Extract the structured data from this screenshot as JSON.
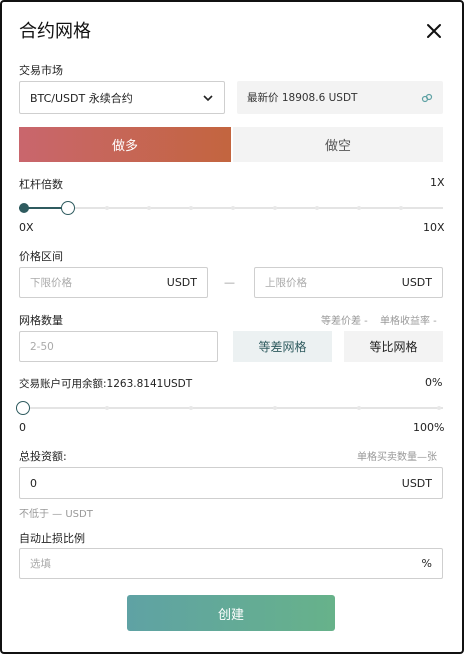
{
  "header": {
    "title": "合约网格"
  },
  "market": {
    "label": "交易市场",
    "selected": "BTC/USDT 永续合约",
    "latest_price": "最新价 18908.6 USDT"
  },
  "direction": {
    "long_label": "做多",
    "short_label": "做空"
  },
  "leverage": {
    "label": "杠杆倍数",
    "current": "1X",
    "min_label": "0X",
    "max_label": "10X",
    "level_fraction": 0.1
  },
  "price_range": {
    "label": "价格区间",
    "lower_placeholder": "下限价格",
    "upper_placeholder": "上限价格",
    "unit": "USDT",
    "separator": "—"
  },
  "grid_count": {
    "label": "网格数量",
    "diff_info": "等差价差 -",
    "yield_info": "单格收益率 -",
    "placeholder": "2-50",
    "arith_label": "等差网格",
    "geo_label": "等比网格"
  },
  "balance": {
    "label": "交易账户可用余额:1263.8141USDT",
    "percent": "0%",
    "min_label": "0",
    "max_label": "100%",
    "level_fraction": 0
  },
  "investment": {
    "label": "总投资额:",
    "per_grid_info": "单格买卖数量—张",
    "value": "0",
    "unit": "USDT",
    "min_note": "不低于 — USDT"
  },
  "stop_loss": {
    "label": "自动止损比例",
    "placeholder": "选填",
    "unit": "%"
  },
  "actions": {
    "create_label": "创建"
  },
  "colors": {
    "accent": "#2f5b5f",
    "long_gradient_start": "#c9666d",
    "long_gradient_end": "#c3653f",
    "create_gradient_start": "#5fa2a4",
    "create_gradient_end": "#67b28a"
  },
  "icons": {
    "close": "close-icon",
    "dropdown": "chevron-down-icon",
    "refresh": "link-icon"
  }
}
